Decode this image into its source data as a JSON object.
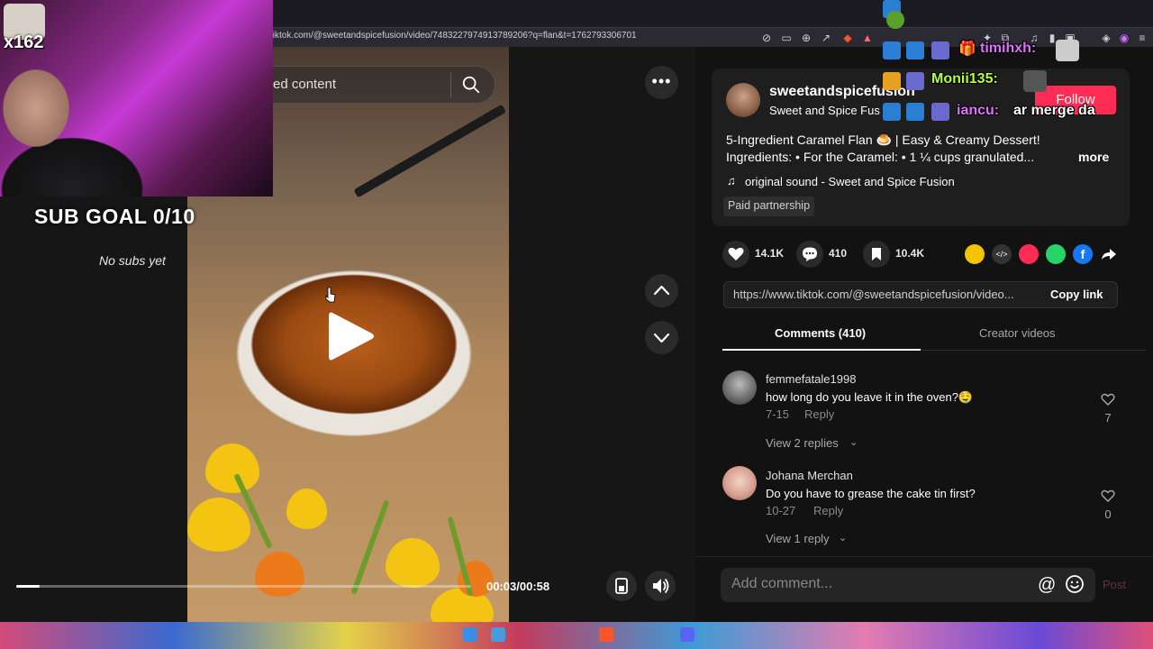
{
  "browser": {
    "url": "tiktok.com/@sweetandspicefusion/video/7483227974913789206?q=flan&t=1762793306701"
  },
  "overlay": {
    "sub_count": "x162",
    "sub_goal": "SUB GOAL 0/10",
    "no_subs": "No subs yet",
    "chat": [
      {
        "user": "timihxh:",
        "message": "",
        "color": "#e070ff"
      },
      {
        "user": "Monii135:",
        "message": "",
        "color": "#b8ff3a"
      },
      {
        "user": "iancu:",
        "message": "ar merge da",
        "color": "#e070ff"
      }
    ]
  },
  "video": {
    "search_placeholder": "ed content",
    "time": "00:03/00:58",
    "progress": 0.052
  },
  "creator": {
    "handle": "sweetandspicefusion",
    "name": "Sweet and Spice Fus",
    "follow_label": "Follow"
  },
  "description": {
    "line1": "5-Ingredient Caramel Flan 🍮 | Easy & Creamy Dessert!",
    "line2": "Ingredients: • For the Caramel: • 1 ¼ cups granulated...",
    "more": "more",
    "music": "original sound - Sweet and Spice Fusion",
    "paid": "Paid partnership"
  },
  "stats": {
    "likes": "14.1K",
    "comments": "410",
    "saves": "10.4K"
  },
  "share": {
    "link": "https://www.tiktok.com/@sweetandspicefusion/video...",
    "copy_label": "Copy link"
  },
  "tabs": {
    "comments": "Comments (410)",
    "creator_videos": "Creator videos"
  },
  "comments": [
    {
      "user": "femmefatale1998",
      "text": "how long do you leave it in the oven?🤤",
      "date": "7-15",
      "reply": "Reply",
      "views": "View 2 replies",
      "likes": "7"
    },
    {
      "user": "Johana Merchan",
      "text": "Do you have to grease the cake tin first?",
      "date": "10-27",
      "reply": "Reply",
      "views": "View 1 reply",
      "likes": "0"
    }
  ],
  "composer": {
    "placeholder": "Add comment...",
    "post_label": "Post"
  },
  "colors": {
    "accent": "#fe2c55",
    "panel": "#121212"
  }
}
